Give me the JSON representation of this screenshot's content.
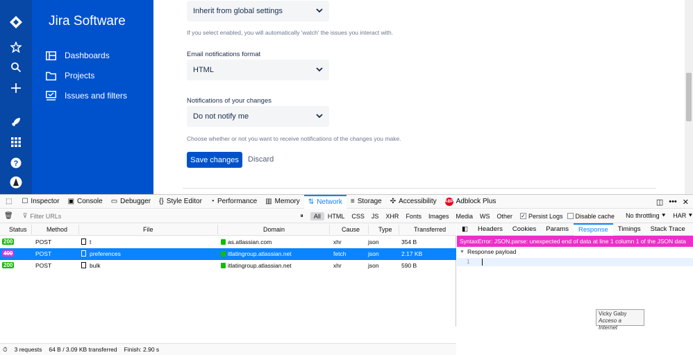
{
  "app": {
    "brand": "Jira Software",
    "nav": [
      {
        "label": "Dashboards",
        "icon": "dashboard-icon"
      },
      {
        "label": "Projects",
        "icon": "folder-icon"
      },
      {
        "label": "Issues and filters",
        "icon": "issues-icon"
      }
    ],
    "rail_icons": [
      "jira-logo-icon",
      "star-icon",
      "search-icon",
      "plus-icon",
      "rocket-icon",
      "apps-grid-icon",
      "help-icon",
      "user-avatar-icon"
    ]
  },
  "settings": {
    "watch_select": "Inherit from global settings",
    "watch_help": "If you select enabled, you will automatically 'watch' the issues you interact with.",
    "email_format_label": "Email notifications format",
    "email_format_select": "HTML",
    "own_changes_label": "Notifications of your changes",
    "own_changes_select": "Do not notify me",
    "own_changes_help": "Choose whether or not you want to receive notifications of the changes you make.",
    "save_label": "Save changes",
    "discard_label": "Discard"
  },
  "devtools": {
    "tabs": [
      {
        "label": "Inspector",
        "icon": "☐"
      },
      {
        "label": "Console",
        "icon": "▣"
      },
      {
        "label": "Debugger",
        "icon": "▭"
      },
      {
        "label": "Style Editor",
        "icon": "{}"
      },
      {
        "label": "Performance",
        "icon": "◔"
      },
      {
        "label": "Memory",
        "icon": "▥"
      },
      {
        "label": "Network",
        "icon": "⇅",
        "active": true
      },
      {
        "label": "Storage",
        "icon": "≡"
      },
      {
        "label": "Accessibility",
        "icon": "✣"
      },
      {
        "label": "Adblock Plus",
        "icon": "ABP"
      }
    ],
    "filter_placeholder": "Filter URLs",
    "types": [
      "All",
      "HTML",
      "CSS",
      "JS",
      "XHR",
      "Fonts",
      "Images",
      "Media",
      "WS",
      "Other"
    ],
    "persist_logs": "Persist Logs",
    "disable_cache": "Disable cache",
    "throttling": "No throttling ⯆",
    "har": "HAR ⯆",
    "columns": [
      "Status",
      "Method",
      "File",
      "Domain",
      "Cause",
      "Type",
      "Transferred"
    ],
    "requests": [
      {
        "status": "200",
        "method": "POST",
        "file": "t",
        "domain": "as.atlassian.com",
        "cause": "xhr",
        "type": "json",
        "transferred": "354 B"
      },
      {
        "status": "400",
        "method": "POST",
        "file": "preferences",
        "domain": "itlatingroup.atlassian.net",
        "cause": "fetch",
        "type": "json",
        "transferred": "2.17 KB"
      },
      {
        "status": "200",
        "method": "POST",
        "file": "bulk",
        "domain": "itlatingroup.atlassian.net",
        "cause": "xhr",
        "type": "json",
        "transferred": "590 B"
      }
    ],
    "summary": {
      "requests": "3 requests",
      "transferred": "64 B / 3.09 KB transferred",
      "finish": "Finish: 2.90 s"
    },
    "detail_tabs": [
      "Headers",
      "Cookies",
      "Params",
      "Response",
      "Timings",
      "Stack Trace"
    ],
    "error": "SyntaxError: JSON.parse: unexpected end of data at line 1 column 1 of the JSON data",
    "payload_label": "Response payload",
    "line_number": "1"
  },
  "tooltip": {
    "line1": "Vicky Gaby",
    "line2": "Acceso a Internet"
  }
}
